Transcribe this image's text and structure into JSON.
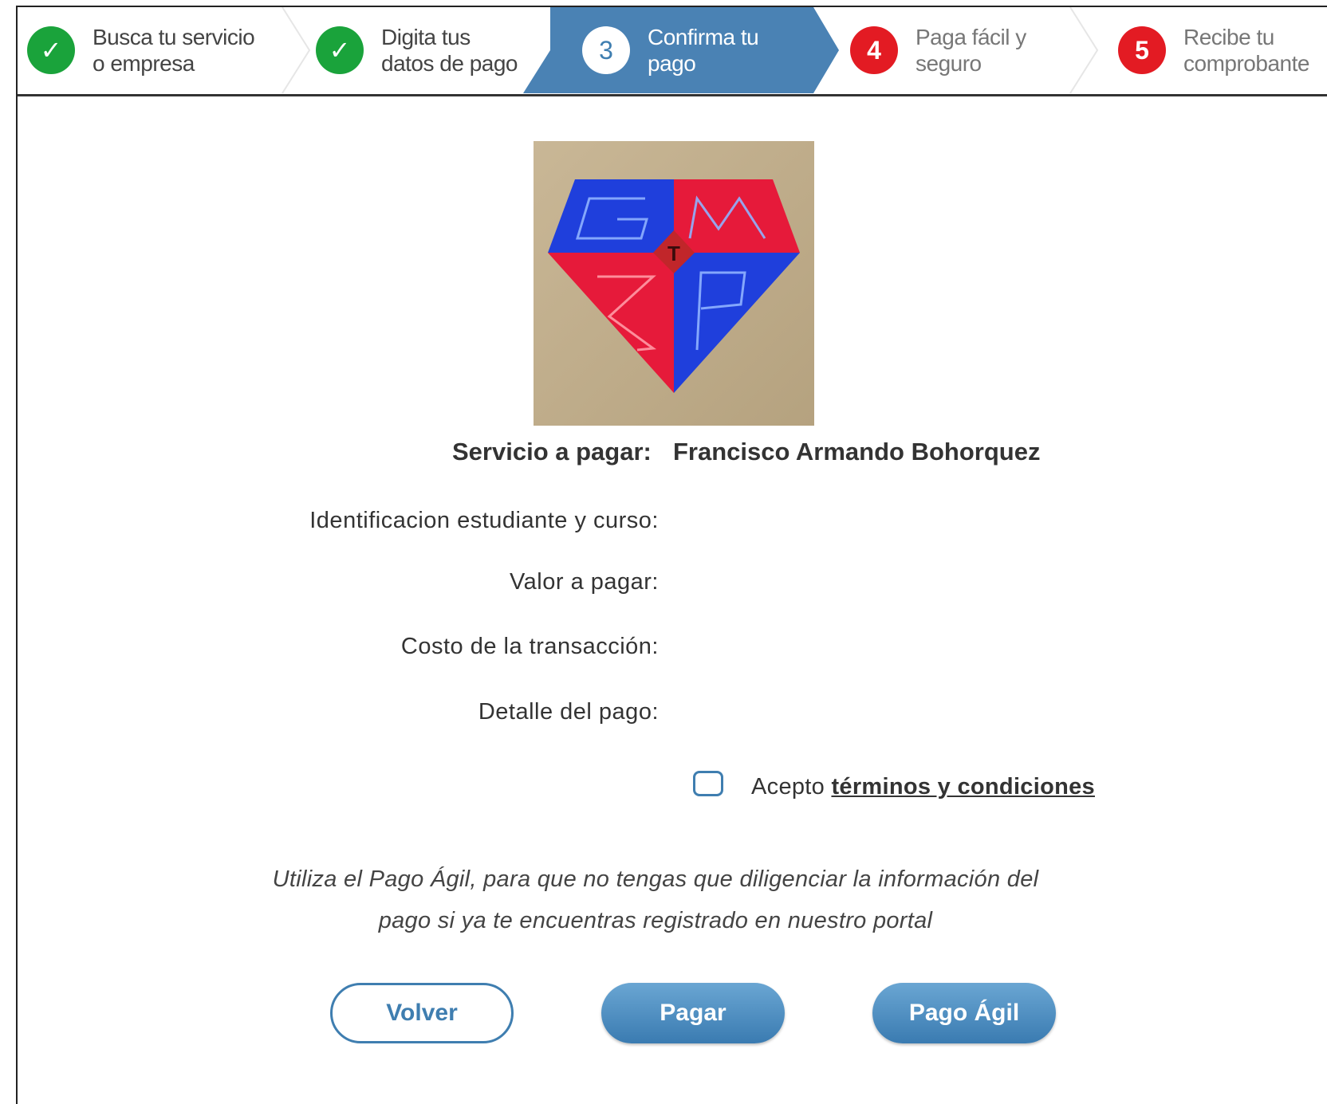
{
  "steps": [
    {
      "marker": "✓",
      "label": "Busca tu servicio\no empresa",
      "state": "done"
    },
    {
      "marker": "✓",
      "label": "Digita tus\ndatos de pago",
      "state": "done"
    },
    {
      "marker": "3",
      "label": "Confirma tu\npago",
      "state": "current"
    },
    {
      "marker": "4",
      "label": "Paga fácil y\nseguro",
      "state": "todo"
    },
    {
      "marker": "5",
      "label": "Recibe tu\ncomprobante",
      "state": "todo"
    }
  ],
  "logo": {
    "letters": [
      "G",
      "M",
      "S",
      "P",
      "T"
    ]
  },
  "service": {
    "label": "Servicio a pagar:",
    "value": "Francisco Armando Bohorquez"
  },
  "fields": {
    "identificacion": "Identificacion estudiante y curso:",
    "valor": "Valor a pagar:",
    "costo": "Costo de la transacción:",
    "detalle": "Detalle del pago:"
  },
  "terms": {
    "prefix": "Acepto",
    "link": "términos y condiciones",
    "checked": false
  },
  "info": {
    "line1": "Utiliza el Pago Ágil, para que no tengas que diligenciar la información del",
    "line2": "pago si ya te encuentras registrado en nuestro portal"
  },
  "buttons": {
    "back": "Volver",
    "pay": "Pagar",
    "quick_pay": "Pago Ágil"
  },
  "colors": {
    "done": "#1aa33b",
    "current": "#3f7eb0",
    "todo": "#e31b23"
  }
}
